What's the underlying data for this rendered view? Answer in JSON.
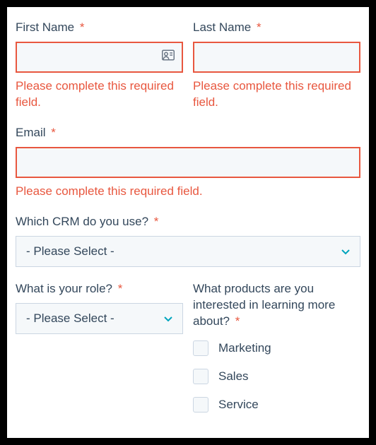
{
  "firstName": {
    "label": "First Name",
    "error": "Please complete this required field."
  },
  "lastName": {
    "label": "Last Name",
    "error": "Please complete this required field."
  },
  "email": {
    "label": "Email",
    "error": "Please complete this required field."
  },
  "crm": {
    "label": "Which CRM do you use?",
    "placeholder": "- Please Select -"
  },
  "role": {
    "label": "What is your role?",
    "placeholder": "- Please Select -"
  },
  "products": {
    "label": "What products are you interested in learning more about?",
    "options": {
      "marketing": "Marketing",
      "sales": "Sales",
      "service": "Service"
    }
  },
  "required_marker": "*"
}
